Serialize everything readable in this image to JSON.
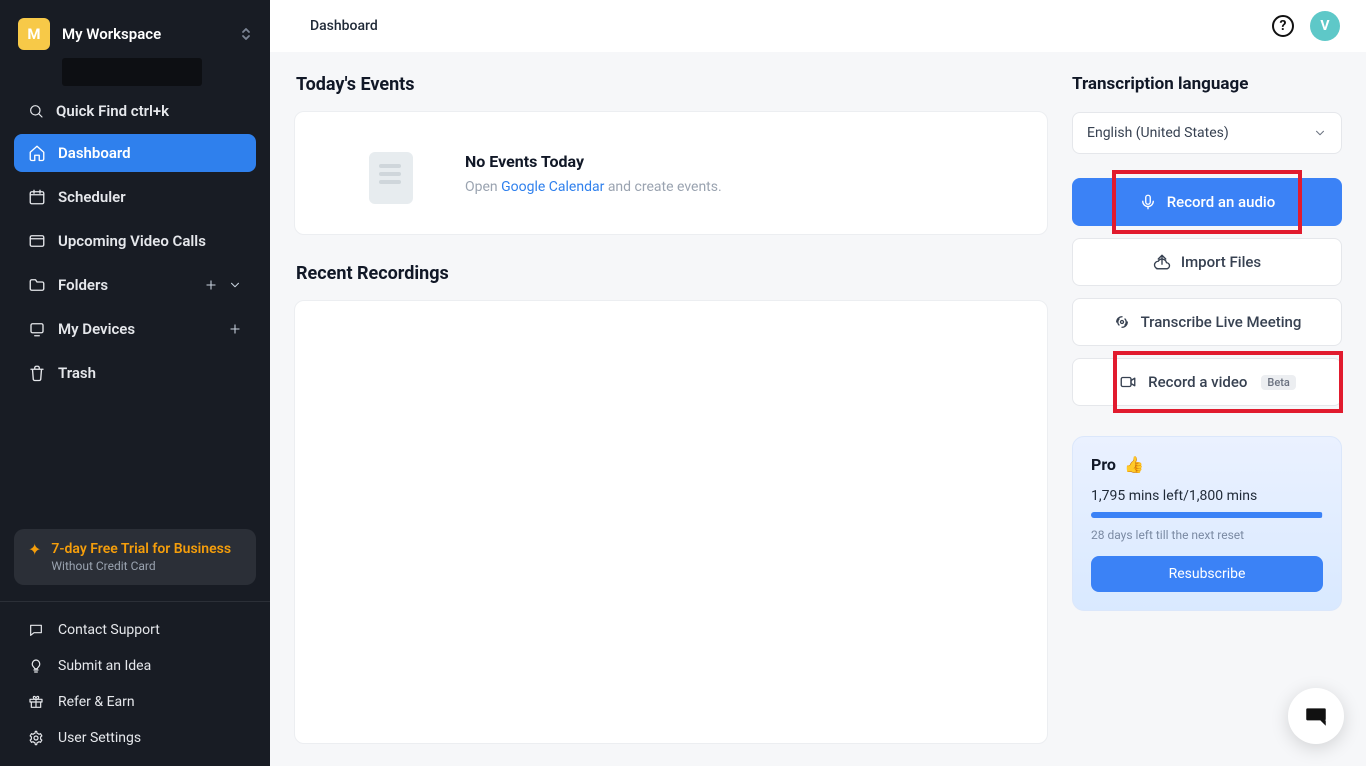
{
  "workspace": {
    "avatar_letter": "M",
    "name": "My Workspace"
  },
  "quickfind_label": "Quick Find ctrl+k",
  "nav": {
    "dashboard": "Dashboard",
    "scheduler": "Scheduler",
    "upcoming": "Upcoming Video Calls",
    "folders": "Folders",
    "devices": "My Devices",
    "trash": "Trash"
  },
  "trial": {
    "title": "7-day Free Trial for Business",
    "subtitle": "Without Credit Card"
  },
  "footer": {
    "contact": "Contact Support",
    "idea": "Submit an Idea",
    "refer": "Refer & Earn",
    "settings": "User Settings"
  },
  "topbar": {
    "title": "Dashboard",
    "help_glyph": "?",
    "avatar_letter": "V"
  },
  "events": {
    "section_title": "Today's Events",
    "headline": "No Events Today",
    "prefix": "Open ",
    "link": "Google Calendar",
    "suffix": " and create events."
  },
  "recordings": {
    "section_title": "Recent Recordings"
  },
  "lang": {
    "title": "Transcription language",
    "selected": "English (United States)"
  },
  "actions": {
    "record_audio": "Record an audio",
    "import_files": "Import Files",
    "transcribe_live": "Transcribe Live Meeting",
    "record_video": "Record a video",
    "beta_tag": "Beta"
  },
  "pro": {
    "title": "Pro",
    "mins": "1,795 mins left/1,800 mins",
    "days": "28 days left till the next reset",
    "cta": "Resubscribe"
  }
}
